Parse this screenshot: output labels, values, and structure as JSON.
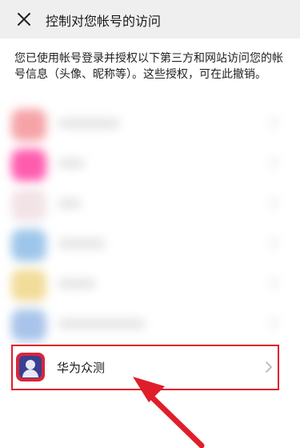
{
  "header": {
    "title": "控制对您帐号的访问"
  },
  "description": "您已使用帐号登录并授权以下第三方和网站访问您的帐号信息（头像、昵称等）。这些授权，可在此撤销。",
  "blurred_rows": [
    {
      "icon_color": "#f6a3a8",
      "text_color": "#e6e6e6"
    },
    {
      "icon_color": "#ff5cae",
      "text_color": "#e6e6e6"
    },
    {
      "icon_color": "#f2e3e6",
      "text_color": "#ececec"
    },
    {
      "icon_color": "#9ec6ea",
      "text_color": "#e6e6e6"
    },
    {
      "icon_color": "#f2dc9a",
      "text_color": "#e6e6e6"
    },
    {
      "icon_color": "#a9c4ea",
      "text_color": "#e6e6e6"
    }
  ],
  "app": {
    "name": "华为众测",
    "icon": "huawei-crowdtest-icon"
  },
  "colors": {
    "header_bg": "#efefef",
    "highlight": "#e01e2b"
  }
}
